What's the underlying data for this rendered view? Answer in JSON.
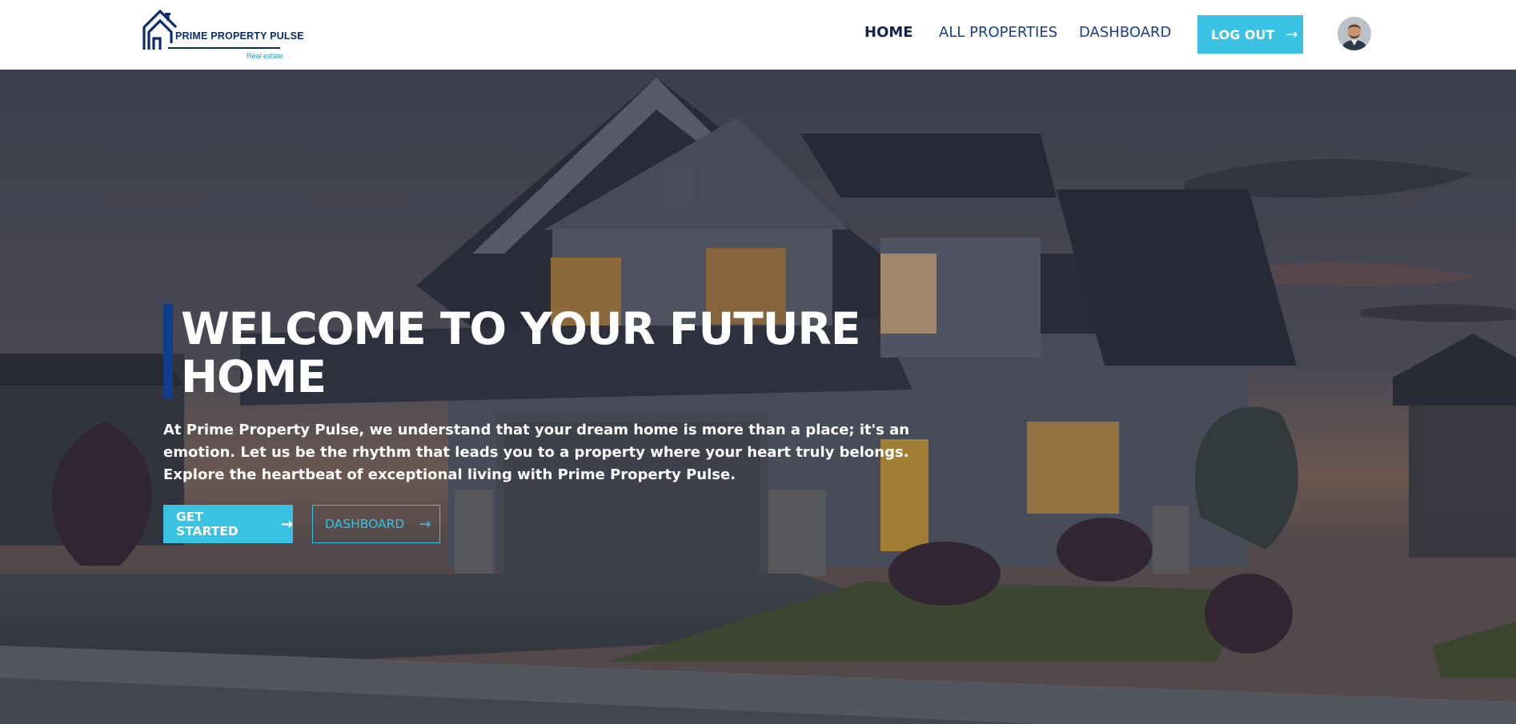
{
  "header": {
    "logo": {
      "title": "PRIME PROPERTY PULSE",
      "subtitle": "Real estate",
      "icon": "house-outline-icon"
    },
    "nav": [
      {
        "label": "HOME",
        "active": true
      },
      {
        "label": "ALL PROPERTIES",
        "active": false
      },
      {
        "label": "DASHBOARD",
        "active": false
      }
    ],
    "logout": {
      "label": "LOG OUT",
      "icon": "arrow-right-icon"
    },
    "avatar": {
      "icon": "user-avatar-icon"
    }
  },
  "hero": {
    "title_line1": "WELCOME TO YOUR FUTURE",
    "title_line2": "HOME",
    "description": "At Prime Property Pulse, we understand that your dream home is more than a place; it's an emotion. Let us be the rhythm that leads you to a property where your heart truly belongs. Explore the heartbeat of exceptional living with Prime Property Pulse.",
    "primary_button": {
      "label": "GET STARTED",
      "icon": "arrow-right-icon"
    },
    "secondary_button": {
      "label": "DASHBOARD",
      "icon": "arrow-right-icon"
    }
  },
  "colors": {
    "brand_navy": "#0d2c6b",
    "accent_cyan": "#3ac2e3",
    "accent_bar": "#0f3d8c",
    "nav_text": "#16408c"
  }
}
